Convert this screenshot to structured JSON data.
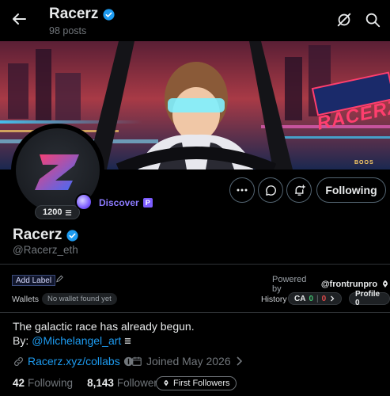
{
  "header": {
    "name": "Racerz",
    "posts": "98 posts"
  },
  "banner": {
    "sign_text": "RACERZ",
    "side_text": "BOOS"
  },
  "profile": {
    "score": "1200",
    "discover_label": "Discover",
    "discover_badge": "P",
    "name": "Racerz",
    "handle": "@Racerz_eth",
    "follow_label": "Following"
  },
  "extension": {
    "add_label": "Add Label",
    "powered_by": "Powered by",
    "powered_brand": "@frontrunpro",
    "wallets_label": "Wallets",
    "wallets_value": "No wallet found yet",
    "history_label": "History",
    "ca_label": "CA",
    "ca_green": "0",
    "ca_sep": "|",
    "ca_red": "0",
    "profile_label": "Profile 0"
  },
  "bio": {
    "line1": "The galactic race has already begun.",
    "by_label": "By:",
    "by_link": "@Michelangel_art"
  },
  "meta": {
    "website": "Racerz.xyz/collabs",
    "joined": "Joined May 2026"
  },
  "follows": {
    "following_count": "42",
    "following_label": "Following",
    "followers_count": "8,143",
    "followers_label": "Followers",
    "first_followers": "First Followers"
  },
  "colors": {
    "accent_blue": "#1d9bf0",
    "discover_purple": "#8d7bff",
    "green": "#3fbf6e",
    "red": "#e04a4a"
  }
}
